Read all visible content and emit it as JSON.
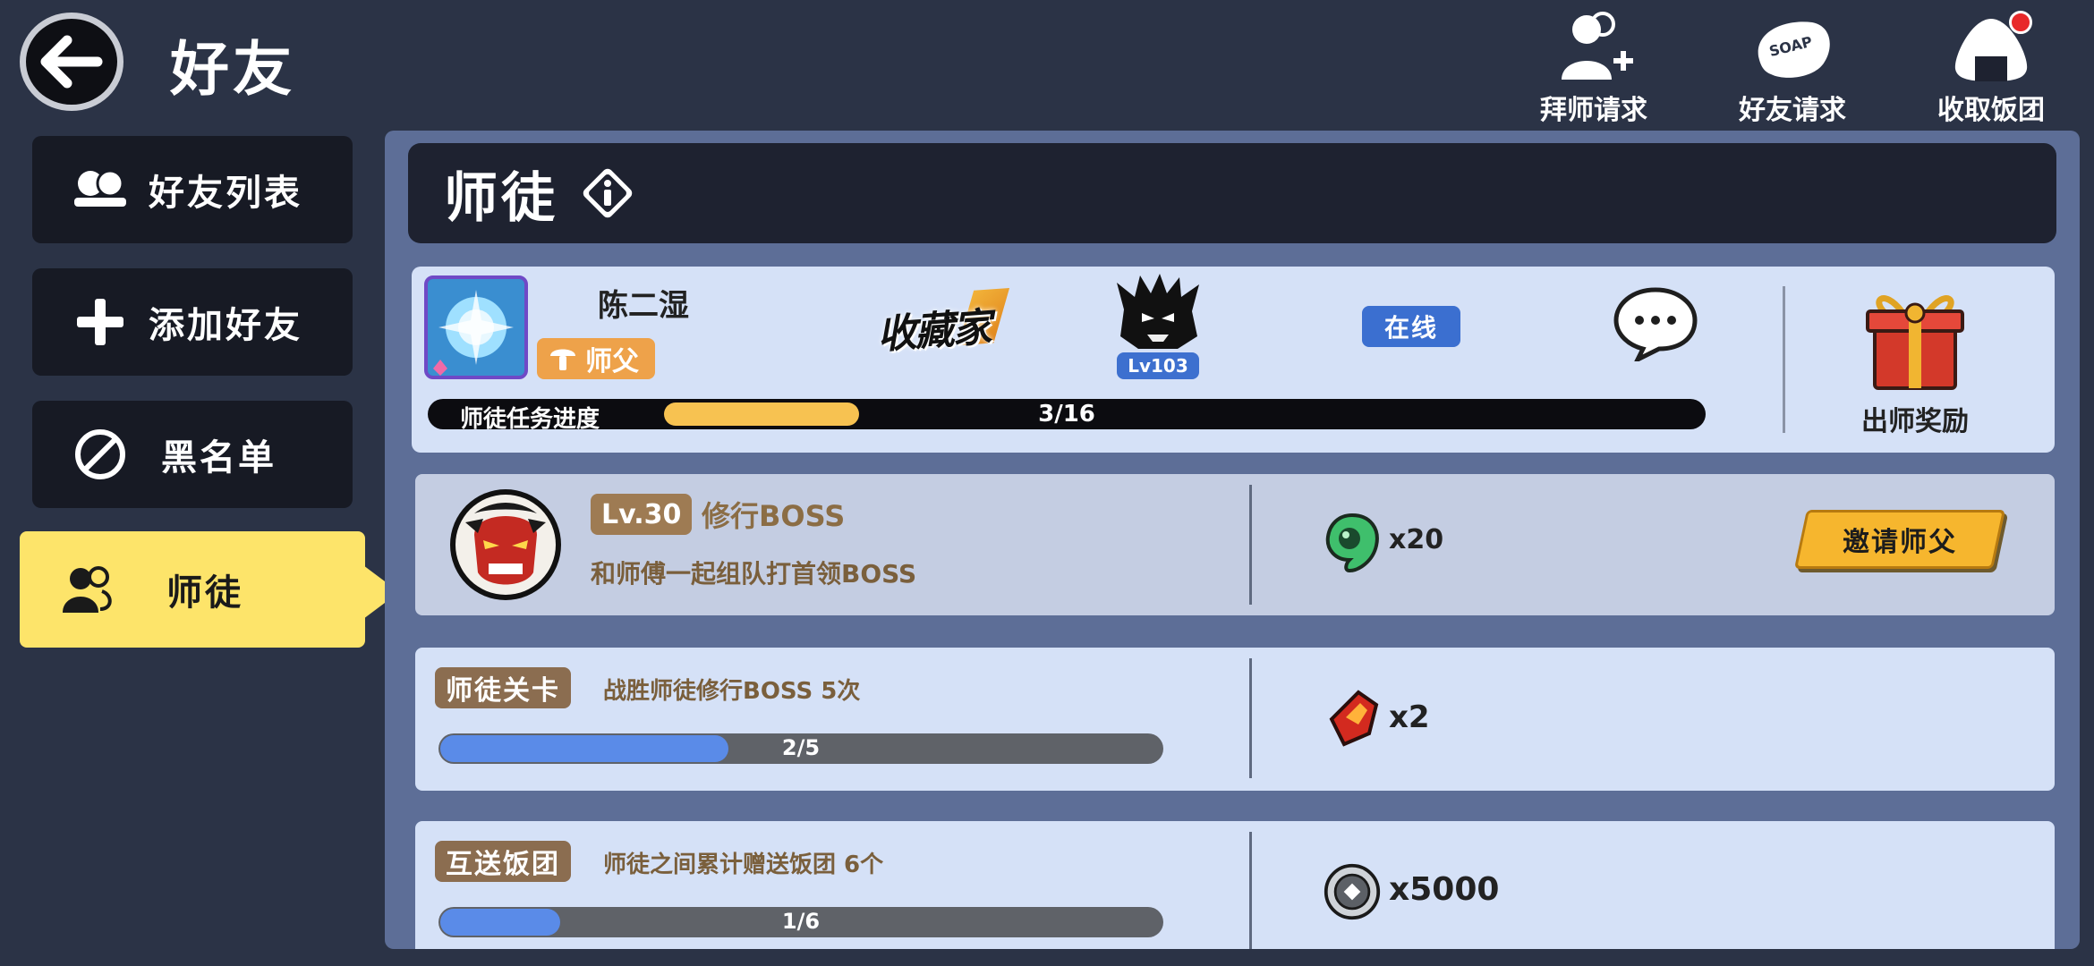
{
  "header": {
    "title": "好友",
    "actions": [
      {
        "label": "拜师请求",
        "icon": "user-add-icon"
      },
      {
        "label": "好友请求",
        "icon": "soap-icon"
      },
      {
        "label": "收取饭团",
        "icon": "rice-ball-icon",
        "has_notification": true
      }
    ]
  },
  "sidebar": {
    "items": [
      {
        "label": "好友列表",
        "icon": "friends-icon",
        "active": false
      },
      {
        "label": "添加好友",
        "icon": "plus-icon",
        "active": false
      },
      {
        "label": "黑名单",
        "icon": "block-icon",
        "active": false
      },
      {
        "label": "师徒",
        "icon": "mentor-icon",
        "active": true
      }
    ]
  },
  "section": {
    "title": "师徒",
    "info_icon": "info-icon"
  },
  "master": {
    "name": "陈二湿",
    "role": "师父",
    "title_badge": "收藏家",
    "level": "Lv103",
    "status": "在线",
    "progress_label": "师徒任务进度",
    "progress_text": "3/16",
    "progress_value": 0.1875,
    "reward_label": "出师奖励"
  },
  "tasks": [
    {
      "level": "Lv.30",
      "title": "修行BOSS",
      "desc": "和师傅一起组队打首领BOSS",
      "reward_icon": "green-gem-icon",
      "reward_qty": "x20",
      "button": "邀请师父"
    },
    {
      "tag": "师徒关卡",
      "desc": "战胜师徒修行BOSS 5次",
      "progress_text": "2/5",
      "progress_value": 0.4,
      "reward_icon": "red-crystal-icon",
      "reward_qty": "x2"
    },
    {
      "tag": "互送饭团",
      "desc": "师徒之间累计赠送饭团 6个",
      "progress_text": "1/6",
      "progress_value": 0.1667,
      "reward_icon": "silver-coin-icon",
      "reward_qty": "x5000"
    }
  ],
  "colors": {
    "background": "#2b3346",
    "panel": "#5d6e97",
    "card": "#d5e1f7",
    "active_tab": "#fde46a",
    "progress_gold": "#f7c251",
    "progress_blue": "#5a8be8",
    "button_gold": "#f6b62e"
  }
}
